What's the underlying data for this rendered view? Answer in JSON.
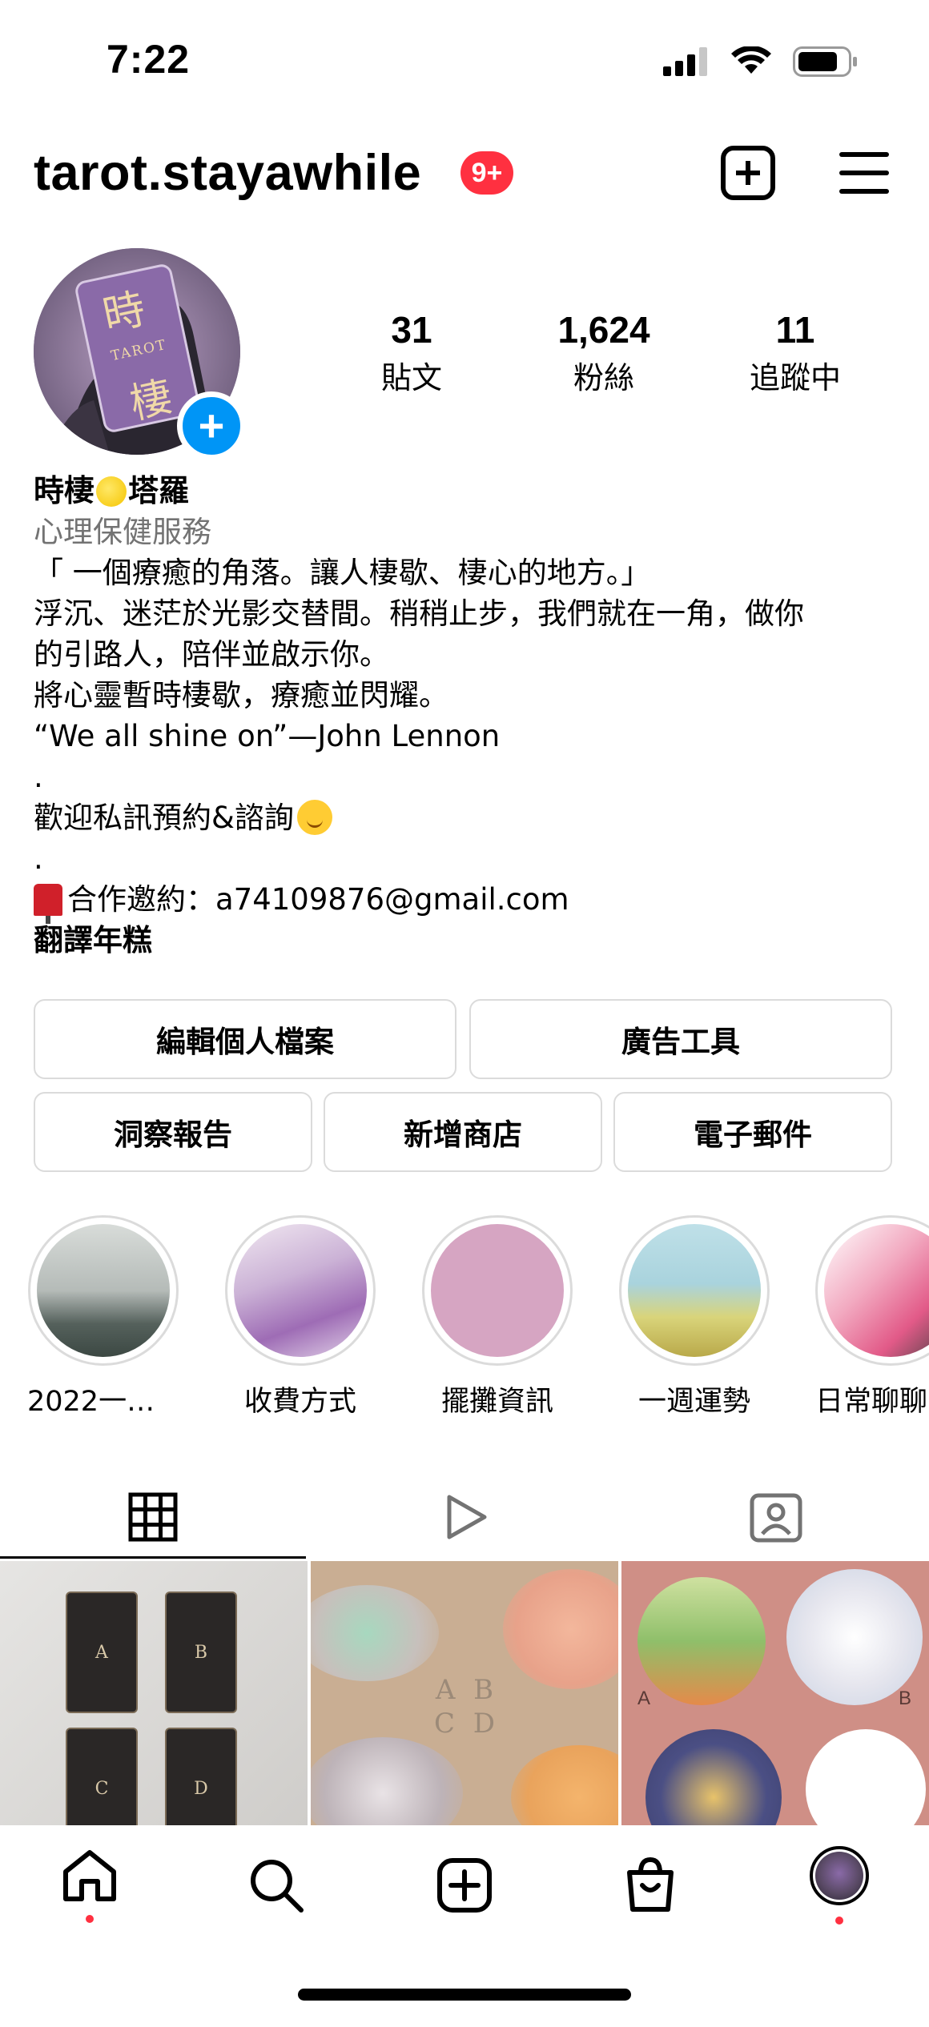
{
  "status_bar": {
    "time": "7:22"
  },
  "header": {
    "username": "tarot.stayawhile",
    "notification_badge": "9+"
  },
  "avatar": {
    "title_char_1": "時",
    "title_char_2": "棲",
    "word": "TAROT"
  },
  "stats": [
    {
      "value": "31",
      "label": "貼文"
    },
    {
      "value": "1,624",
      "label": "粉絲"
    },
    {
      "value": "11",
      "label": "追蹤中"
    }
  ],
  "bio": {
    "name_part1": "時棲",
    "name_part2": "塔羅",
    "category": "心理保健服務",
    "line1": "「 一個療癒的角落。讓人棲歇、棲心的地方。」",
    "line2": "浮沉、迷茫於光影交替間。稍稍止步，我們就在一角，做你",
    "line3": "的引路人，陪伴並啟示你。",
    "line4": "將心靈暫時棲歇，療癒並閃耀。",
    "line5": "“We all shine on”—John Lennon",
    "dot1": ".",
    "line6": "歡迎私訊預約&諮詢",
    "dot2": ".",
    "line7": "合作邀約：a74109876@gmail.com",
    "translate": "翻譯年糕"
  },
  "buttons": {
    "edit_profile": "編輯個人檔案",
    "ad_tools": "廣告工具",
    "insights": "洞察報告",
    "add_shop": "新增商店",
    "email": "電子郵件"
  },
  "highlights": [
    {
      "label": "2022一週…"
    },
    {
      "label": "收費方式"
    },
    {
      "label": "擺攤資訊"
    },
    {
      "label": "一週運勢"
    },
    {
      "label": "日常聊聊"
    }
  ],
  "posts": {
    "post1": {
      "a": "A",
      "b": "B",
      "c": "C",
      "d": "D"
    },
    "post2": {
      "line1": "A B",
      "line2": "C D"
    },
    "post3": {
      "a": "A",
      "b": "B"
    }
  },
  "colors": {
    "badge": "#ff3040",
    "add_story": "#0095f6",
    "border": "#dbdbdb",
    "muted": "#737373"
  },
  "icons": [
    "create-post-icon",
    "menu-icon",
    "grid-icon",
    "reels-icon",
    "tagged-icon",
    "home-icon",
    "search-icon",
    "new-post-icon",
    "shop-icon",
    "profile-avatar-icon"
  ]
}
